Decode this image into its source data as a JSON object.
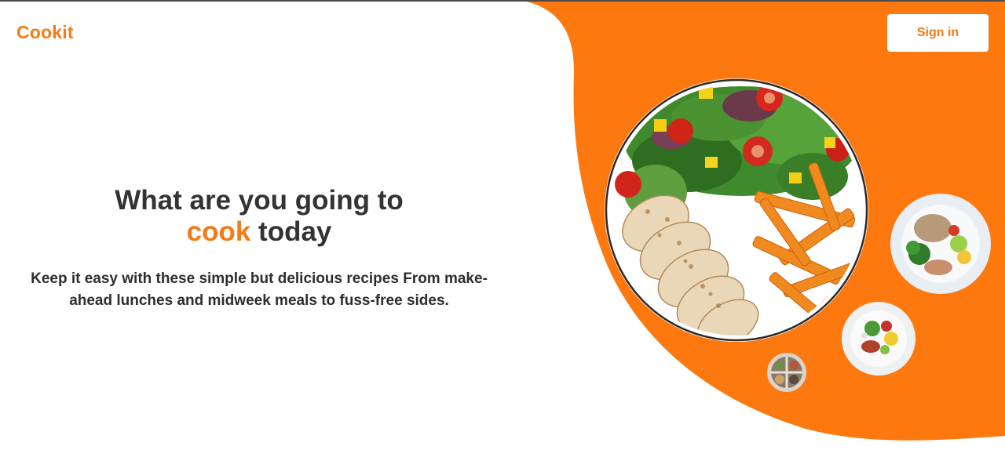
{
  "header": {
    "logo": "Cookit",
    "sign_in_label": "Sign in"
  },
  "hero": {
    "headline_line1": "What are you going to",
    "headline_highlight": "cook",
    "headline_line2_rest": " today",
    "subtext": "Keep it easy with these simple but delicious recipes From make-ahead lunches and midweek meals to fuss-free sides."
  },
  "colors": {
    "accent": "#f47b16",
    "text": "#333333",
    "background": "#ffffff"
  },
  "images": [
    "chicken-salad-fries-plate",
    "rice-vegetables-plate",
    "salad-bowl-plate",
    "mini-meal-plate"
  ]
}
